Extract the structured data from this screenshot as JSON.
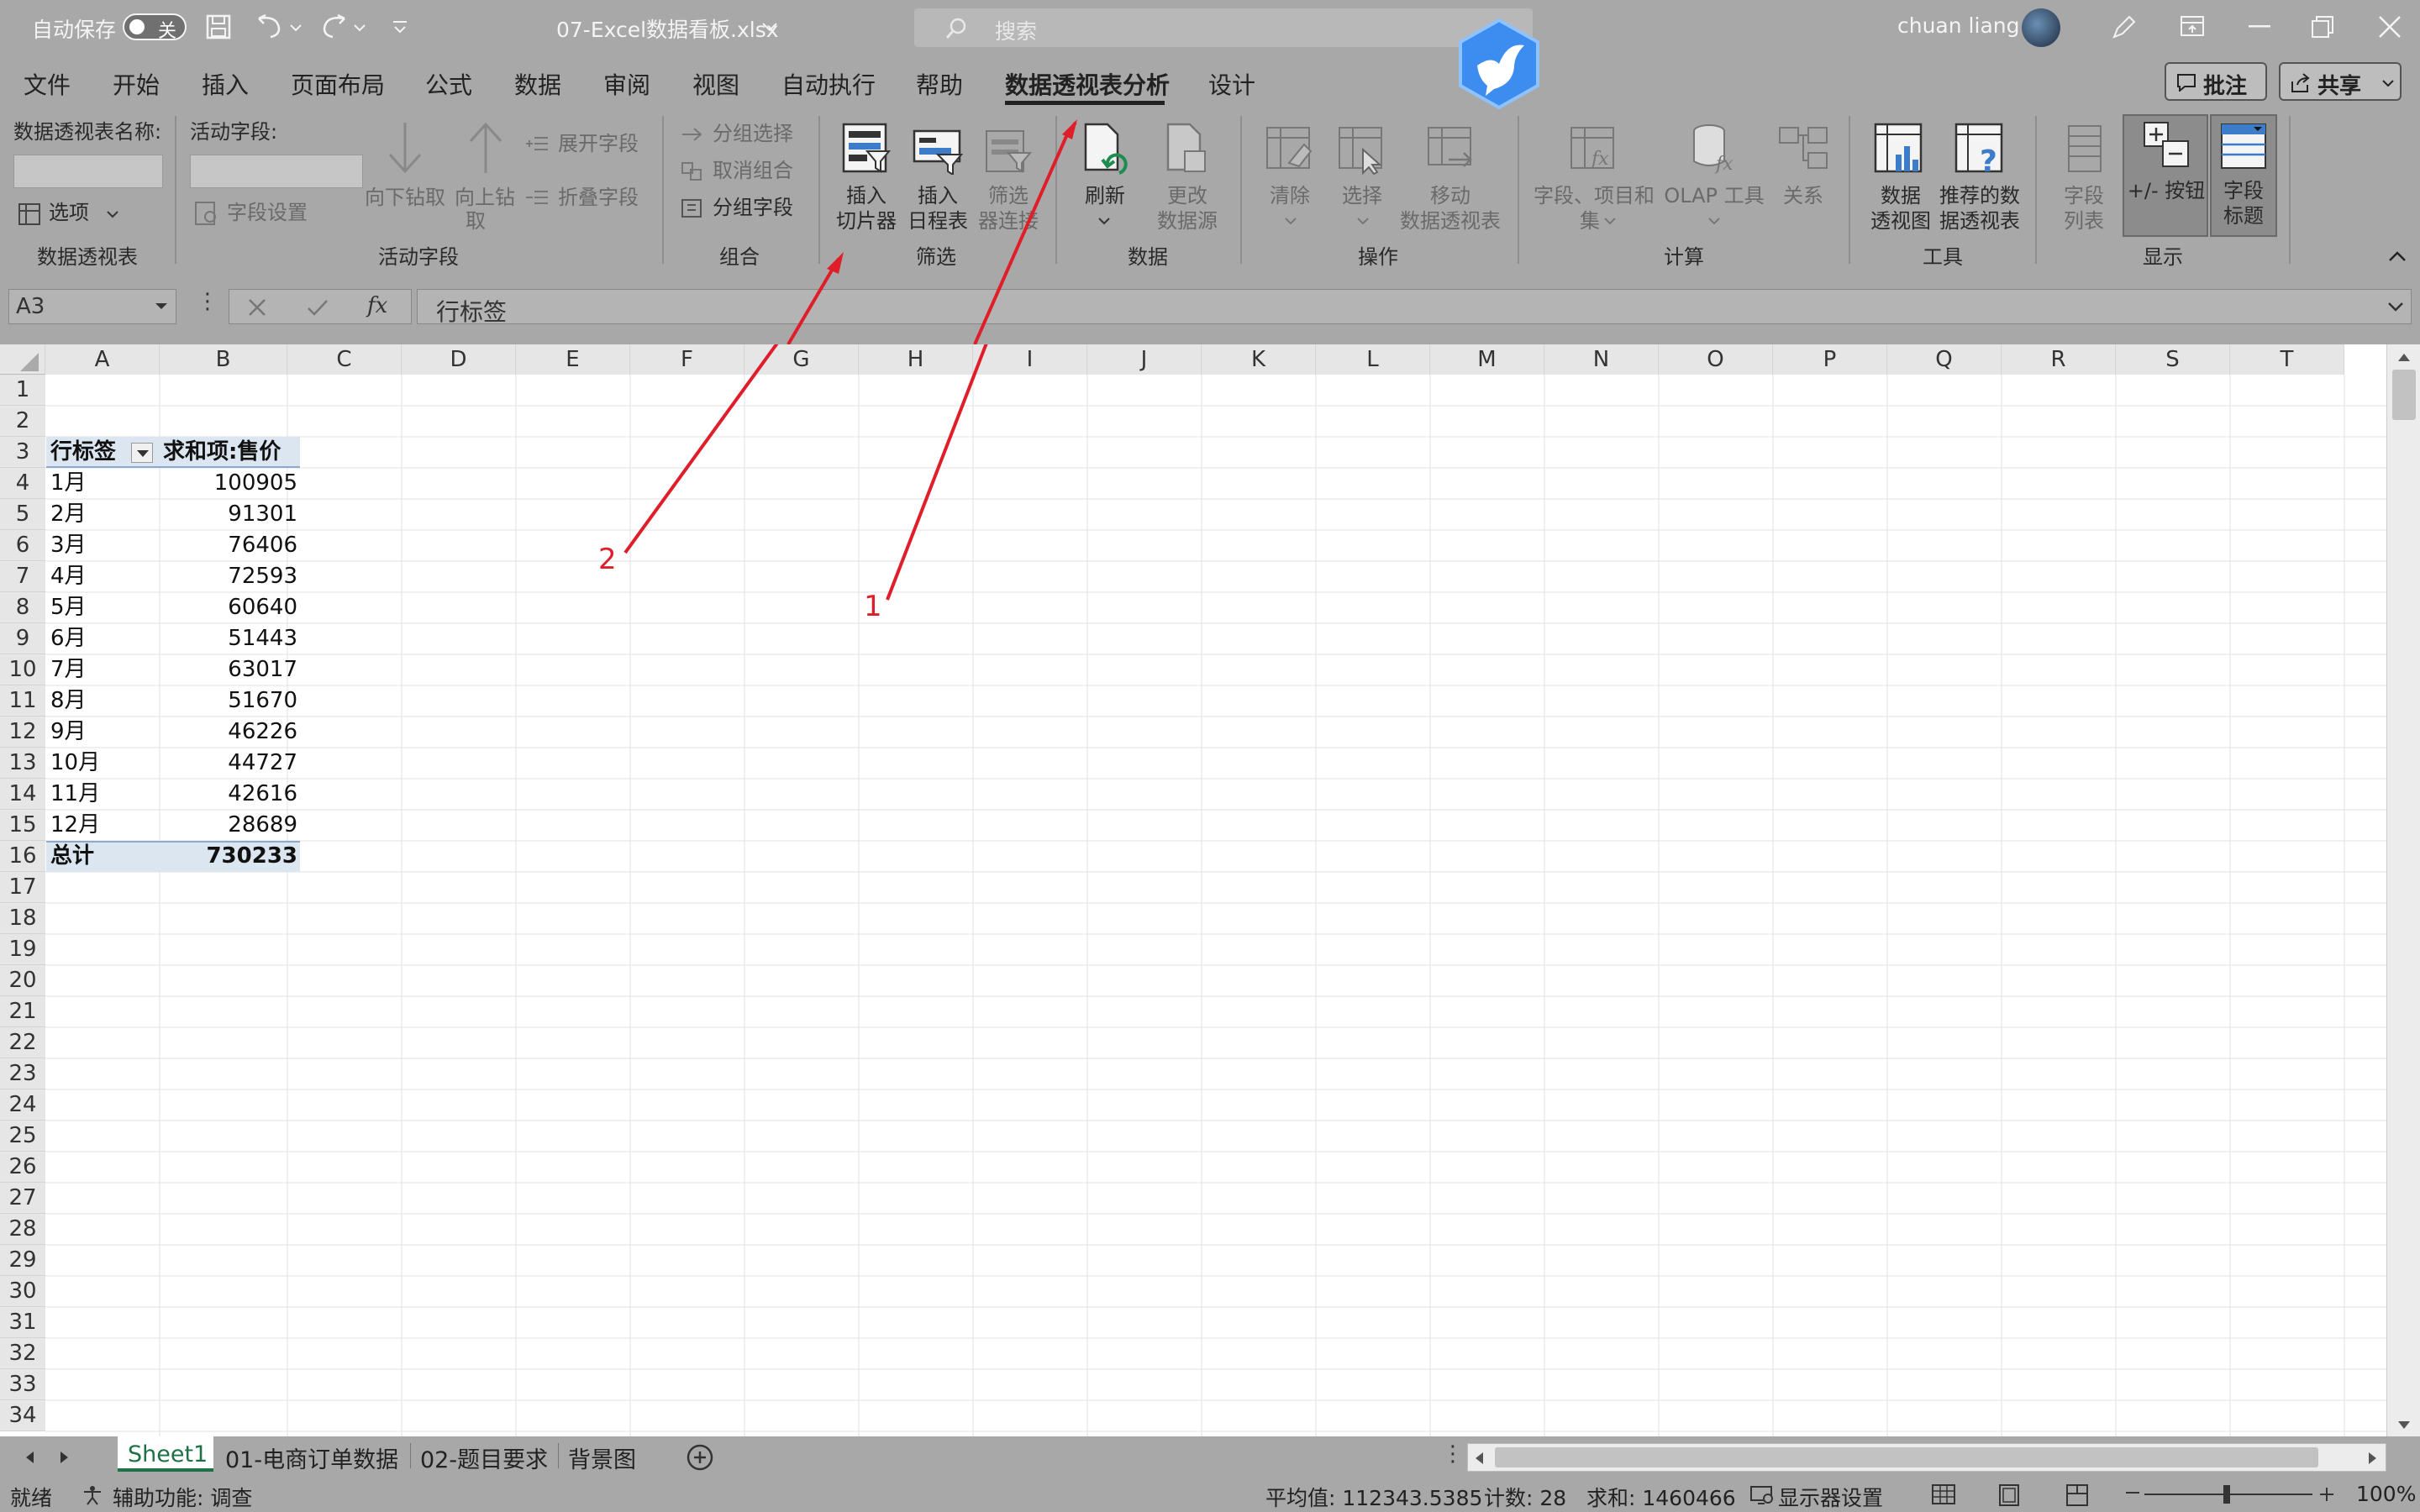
{
  "titlebar": {
    "autosave_label": "自动保存",
    "autosave_state": "关",
    "filename": "07-Excel数据看板.xlsx",
    "search_placeholder": "搜索",
    "user_name": "chuan liang"
  },
  "menu": {
    "items": [
      "文件",
      "开始",
      "插入",
      "页面布局",
      "公式",
      "数据",
      "审阅",
      "视图",
      "自动执行",
      "帮助",
      "数据透视表分析",
      "设计"
    ],
    "active_index": 10,
    "comment_button": "批注",
    "share_button": "共享"
  },
  "ribbon": {
    "pivot_group": {
      "name_label": "数据透视表名称:",
      "options": "选项",
      "group": "数据透视表"
    },
    "active_field_group": {
      "label": "活动字段:",
      "field_settings": "字段设置",
      "drill_down": "向下钻取",
      "drill_up_1": "向上钻",
      "drill_up_2": "取",
      "expand": "展开字段",
      "collapse": "折叠字段",
      "group": "活动字段"
    },
    "group_group": {
      "group_selection": "分组选择",
      "ungroup": "取消组合",
      "group_field": "分组字段",
      "group": "组合"
    },
    "filter_group": {
      "slicer_1": "插入",
      "slicer_2": "切片器",
      "timeline_1": "插入",
      "timeline_2": "日程表",
      "filter_conn_1": "筛选",
      "filter_conn_2": "器连接",
      "group": "筛选"
    },
    "data_group": {
      "refresh": "刷新",
      "change_1": "更改",
      "change_2": "数据源",
      "group": "数据"
    },
    "actions_group": {
      "clear": "清除",
      "select": "选择",
      "move_1": "移动",
      "move_2": "数据透视表",
      "group": "操作"
    },
    "calc_group": {
      "fields_1": "字段、项目和",
      "fields_2": "集",
      "olap": "OLAP 工具",
      "relations": "关系",
      "group": "计算"
    },
    "tools_group": {
      "pivotchart_1": "数据",
      "pivotchart_2": "透视图",
      "recommended_1": "推荐的数",
      "recommended_2": "据透视表",
      "group": "工具"
    },
    "show_group": {
      "field_list_1": "字段",
      "field_list_2": "列表",
      "buttons": "+/- 按钮",
      "headers_1": "字段",
      "headers_2": "标题",
      "group": "显示"
    }
  },
  "formula_bar": {
    "name_box": "A3",
    "fx": "fx",
    "content": "行标签"
  },
  "columns": [
    "A",
    "B",
    "C",
    "D",
    "E",
    "F",
    "G",
    "H",
    "I",
    "J",
    "K",
    "L",
    "M",
    "N",
    "O",
    "P",
    "Q",
    "R",
    "S",
    "T"
  ],
  "rows": [
    "1",
    "2",
    "3",
    "4",
    "5",
    "6",
    "7",
    "8",
    "9",
    "10",
    "11",
    "12",
    "13",
    "14",
    "15",
    "16",
    "17",
    "18",
    "19",
    "20",
    "21",
    "22",
    "23",
    "24",
    "25",
    "26",
    "27",
    "28",
    "29",
    "30",
    "31",
    "32",
    "33",
    "34"
  ],
  "pivot": {
    "header_row": "行标签",
    "header_value": "求和项:售价",
    "data": [
      {
        "label": "1月",
        "value": "100905"
      },
      {
        "label": "2月",
        "value": "91301"
      },
      {
        "label": "3月",
        "value": "76406"
      },
      {
        "label": "4月",
        "value": "72593"
      },
      {
        "label": "5月",
        "value": "60640"
      },
      {
        "label": "6月",
        "value": "51443"
      },
      {
        "label": "7月",
        "value": "63017"
      },
      {
        "label": "8月",
        "value": "51670"
      },
      {
        "label": "9月",
        "value": "46226"
      },
      {
        "label": "10月",
        "value": "44727"
      },
      {
        "label": "11月",
        "value": "42616"
      },
      {
        "label": "12月",
        "value": "28689"
      }
    ],
    "total_label": "总计",
    "total_value": "730233"
  },
  "annotations": {
    "label_1": "1",
    "label_2": "2",
    "color": "#e01e2a"
  },
  "sheets": {
    "tabs": [
      "Sheet1",
      "01-电商订单数据",
      "02-题目要求",
      "背景图"
    ],
    "active_index": 0
  },
  "status": {
    "ready": "就绪",
    "accessibility": "辅助功能: 调查",
    "average": "平均值: 112343.5385",
    "count": "计数: 28",
    "sum": "求和: 1460466",
    "display_settings": "显示器设置",
    "zoom": "100%"
  },
  "colors": {
    "ribbon_bg": "#a8a8a8",
    "pivot_header": "#dce6f1",
    "accent_green": "#1e7145",
    "arrow_red": "#e01e2a"
  }
}
